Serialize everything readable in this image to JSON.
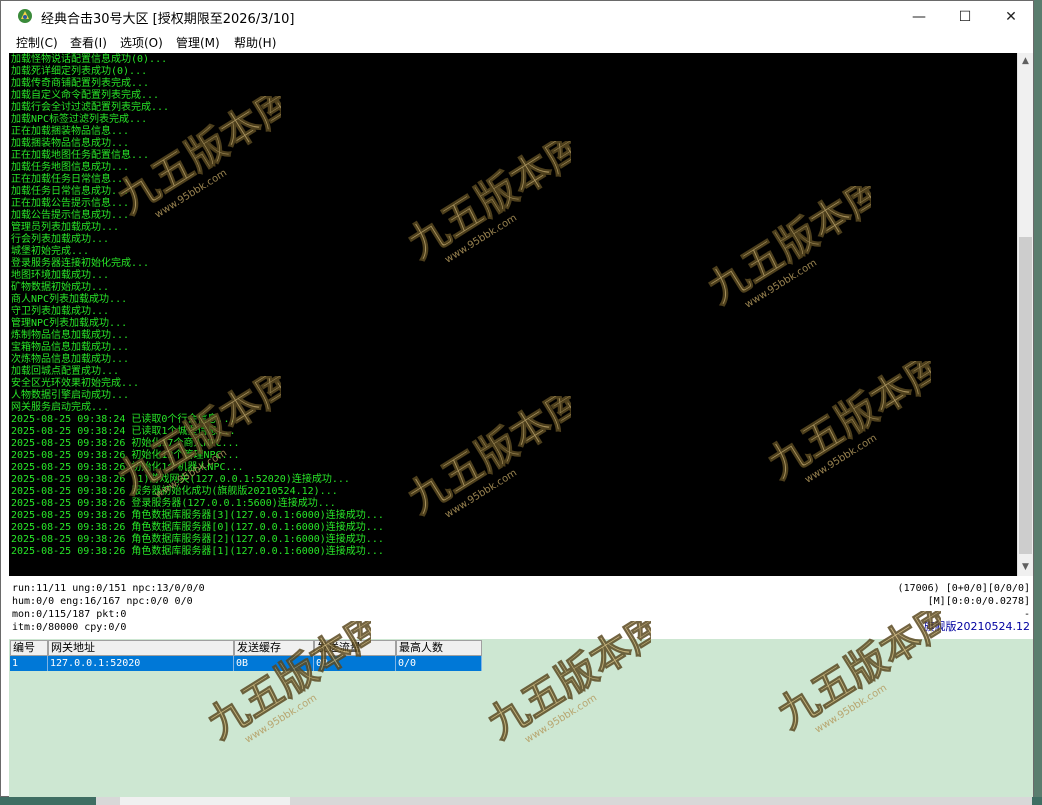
{
  "window": {
    "title": "经典合击30号大区 [授权期限至2026/3/10]",
    "controls": {
      "minimize": "—",
      "maximize": "☐",
      "close": "✕"
    }
  },
  "menu": [
    "控制(C)",
    "查看(I)",
    "选项(O)",
    "管理(M)",
    "帮助(H)"
  ],
  "log": [
    "加载怪物说话配置信息成功(0)...",
    "加载死详细定列表成功(0)...",
    "加载传奇商铺配置列表完成...",
    "加载自定义命令配置列表完成...",
    "加载行会全讨过滤配置列表完成...",
    "加载NPC标签过滤列表完成...",
    "正在加载捆装物品信息...",
    "加载捆装物品信息成功...",
    "正在加载地图任务配置信息...",
    "加载任务地图信息成功...",
    "正在加载任务日常信息...",
    "加载任务日常信息成功...",
    "正在加载公告提示信息...",
    "加载公告提示信息成功...",
    "管理员列表加载成功...",
    "行会列表加载成功...",
    "城堡初始完成...",
    "登录服务器连接初始化完成...",
    "地图环境加载成功...",
    "矿物数据初始成功...",
    "商人NPC列表加载成功...",
    "守卫列表加载成功...",
    "管理NPC列表加载成功...",
    "炼制物品信息加载成功...",
    "宝箱物品信息加载成功...",
    "次炼物品信息加载成功...",
    "加载回城点配置成功...",
    "安全区光环效果初始完成...",
    "人物数据引擎启动成功...",
    "网关服务启动完成...",
    "2025-08-25 09:38:24 已读取0个行会信息...",
    "2025-08-25 09:38:24 已读取1个城堡信息...",
    "2025-08-25 09:38:26 初始化17个商人NPC...",
    "2025-08-25 09:38:26 初始化12个管理NPC...",
    "2025-08-25 09:38:26 初始化1个机器人NPC...",
    "2025-08-25 09:38:26 (1)游戏网关(127.0.0.1:52020)连接成功...",
    "2025-08-25 09:38:26 服务器初始化成功(旗舰版20210524.12)...",
    "2025-08-25 09:38:26 登录服务器(127.0.0.1:5600)连接成功...",
    "2025-08-25 09:38:26 角色数据库服务器[3](127.0.0.1:6000)连接成功...",
    "2025-08-25 09:38:26 角色数据库服务器[0](127.0.0.1:6000)连接成功...",
    "2025-08-25 09:38:26 角色数据库服务器[2](127.0.0.1:6000)连接成功...",
    "2025-08-25 09:38:26 角色数据库服务器[1](127.0.0.1:6000)连接成功..."
  ],
  "status": {
    "left": [
      "run:11/11 ung:0/151 npc:13/0/0/0",
      "hum:0/0 eng:16/167 npc:0/0 0/0",
      "mon:0/115/187 pkt:0",
      "itm:0/80000 cpy:0/0"
    ],
    "right": [
      "(17006) [0+0/0][0/0/0]",
      "[M][0:0:0/0.0278]",
      "-"
    ],
    "edition": "旗舰版20210524.12"
  },
  "grid": {
    "columns": [
      "编号",
      "网关地址",
      "发送缓存",
      "发送流量",
      "最高人数"
    ],
    "rows": [
      [
        "1",
        "127.0.0.1:52020",
        "0B",
        "0B",
        "0/0"
      ]
    ]
  },
  "watermark": {
    "text": "九五版本库",
    "url": "www.95bbk.com"
  },
  "colors": {
    "log_text": "#28e628",
    "log_bg": "#000000",
    "grid_bg": "#cde7d2",
    "selection": "#0078d7"
  }
}
